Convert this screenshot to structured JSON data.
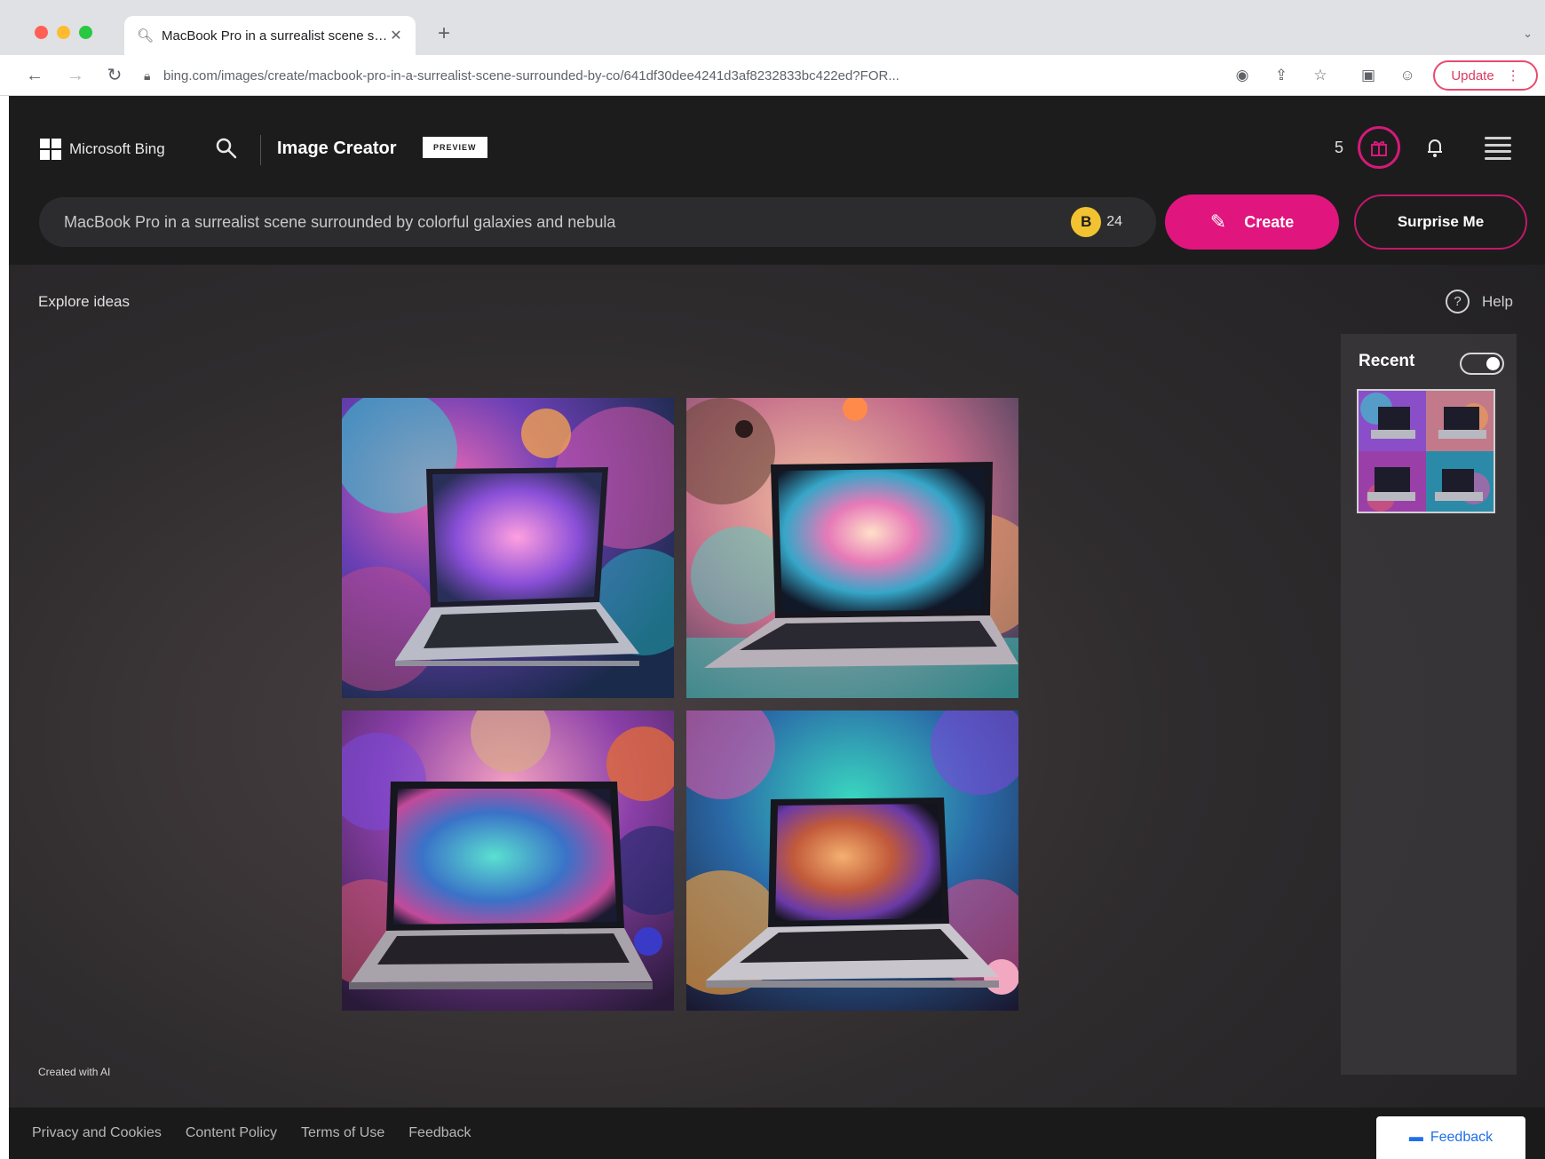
{
  "browser": {
    "tab_title": "MacBook Pro in a surrealist scene surrounded by colorful galaxies and nebula - Bing",
    "url": "bing.com/images/create/macbook-pro-in-a-surrealist-scene-surrounded-by-co/641df30dee4241d3af8232833bc422ed?FOR...",
    "update_label": "Update",
    "icons": [
      "back-arrow",
      "forward-arrow",
      "reload",
      "lock",
      "eye-off",
      "share",
      "star",
      "sidebar",
      "profile",
      "kebab-menu"
    ]
  },
  "header": {
    "brand": "Microsoft Bing",
    "app_title": "Image Creator",
    "badge": "PREVIEW",
    "reward_count": "5",
    "colors": {
      "accent": "#e0157e",
      "reward": "#d41a78",
      "coin": "#f2c230"
    }
  },
  "prompt": {
    "text": "MacBook Pro in a surrealist scene surrounded by colorful galaxies and nebula",
    "boost_letter": "B",
    "boost_count": "24",
    "create_label": "Create",
    "surprise_label": "Surprise Me"
  },
  "main": {
    "explore_label": "Explore ideas",
    "help_label": "Help",
    "help_icon_glyph": "?",
    "created_with_ai": "Created with AI"
  },
  "recent": {
    "title": "Recent",
    "toggle_on": true
  },
  "footer": {
    "links": [
      "Privacy and Cookies",
      "Content Policy",
      "Terms of Use",
      "Feedback"
    ],
    "feedback_button": "Feedback"
  }
}
